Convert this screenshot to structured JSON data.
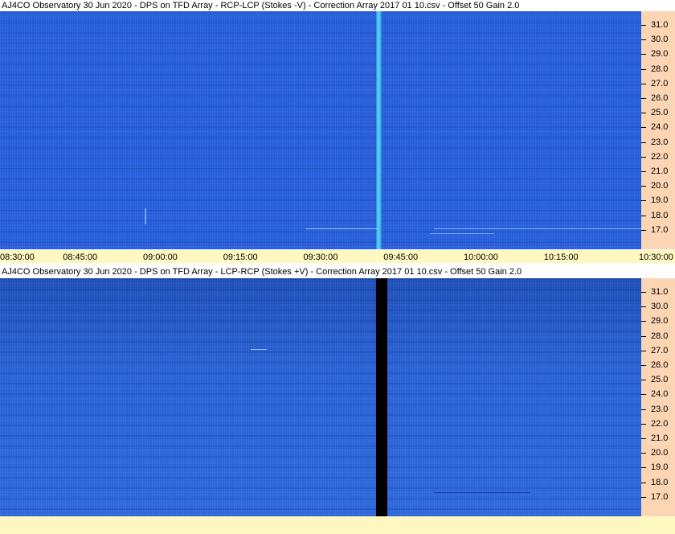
{
  "panels": [
    {
      "title": "AJ4CO Observatory 30 Jun 2020  -  DPS on TFD Array  -  RCP-LCP (Stokes -V)  -  Correction Array 2017 01 10.csv  -  Offset 50  Gain 2.0",
      "colors": {
        "background": "#2860dc",
        "line": "#38c8e8"
      }
    },
    {
      "title": "AJ4CO Observatory 30 Jun 2020  -  DPS on TFD Array  -  LCP-RCP (Stokes +V)  -  Correction Array 2017 01 10.csv  -  Offset 50  Gain 2.0",
      "colors": {
        "background": "#2a64d8",
        "line": "#000000"
      }
    }
  ],
  "frequency_axis": {
    "labels": [
      "31.0",
      "30.0",
      "29.0",
      "28.0",
      "27.0",
      "26.0",
      "25.0",
      "24.0",
      "23.0",
      "22.0",
      "21.0",
      "20.0",
      "19.0",
      "18.0",
      "17.0"
    ]
  },
  "time_axis": {
    "labels": [
      "08:30:00",
      "08:45:00",
      "09:00:00",
      "09:15:00",
      "09:30:00",
      "09:45:00",
      "10:00:00",
      "10:15:00",
      "10:30:00"
    ]
  },
  "colors": {
    "freq_axis_bg": "#fcd6b4",
    "time_axis_bg": "#fff8c0"
  }
}
